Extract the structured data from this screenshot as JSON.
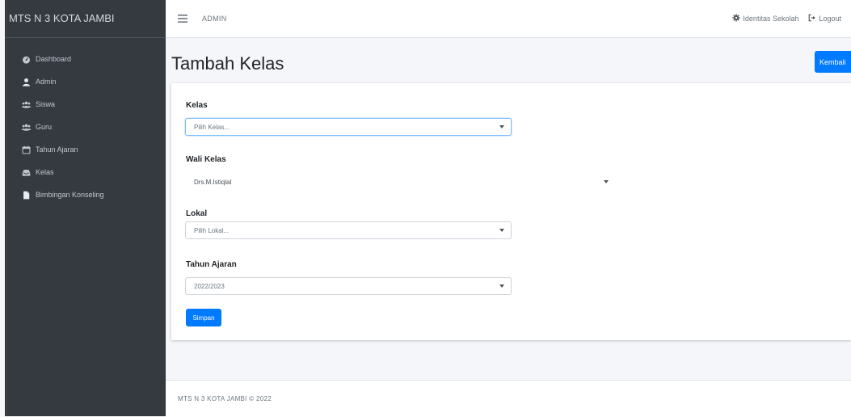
{
  "sidebar": {
    "brand": "MTS N 3 KOTA JAMBI",
    "items": [
      {
        "label": "Dashboard",
        "icon": "dashboard-icon"
      },
      {
        "label": "Admin",
        "icon": "user-icon"
      },
      {
        "label": "Siswa",
        "icon": "users-icon"
      },
      {
        "label": "Guru",
        "icon": "users-icon"
      },
      {
        "label": "Tahun Ajaran",
        "icon": "calendar-icon"
      },
      {
        "label": "Kelas",
        "icon": "inbox-icon"
      },
      {
        "label": "Bimbingan Konseling",
        "icon": "file-icon"
      }
    ]
  },
  "topbar": {
    "menu_icon": "hamburger-icon",
    "user": "ADMIN",
    "identitas": "Identitas Sekolah",
    "logout": "Logout"
  },
  "page": {
    "title": "Tambah Kelas",
    "back_button": "Kembali"
  },
  "form": {
    "kelas": {
      "label": "Kelas",
      "value": "Pilih Kelas..."
    },
    "wali": {
      "label": "Wali Kelas",
      "value": "Drs.M.Istiqlal"
    },
    "lokal": {
      "label": "Lokal",
      "value": "Pilih Lokal..."
    },
    "tahun": {
      "label": "Tahun Ajaran",
      "value": "2022/2023"
    },
    "save_button": "Simpan"
  },
  "footer": {
    "text": "MTS N 3 KOTA JAMBI © 2022"
  },
  "colors": {
    "sidebar_bg": "#343a40",
    "primary": "#007bff",
    "content_bg": "#f4f6f9"
  }
}
